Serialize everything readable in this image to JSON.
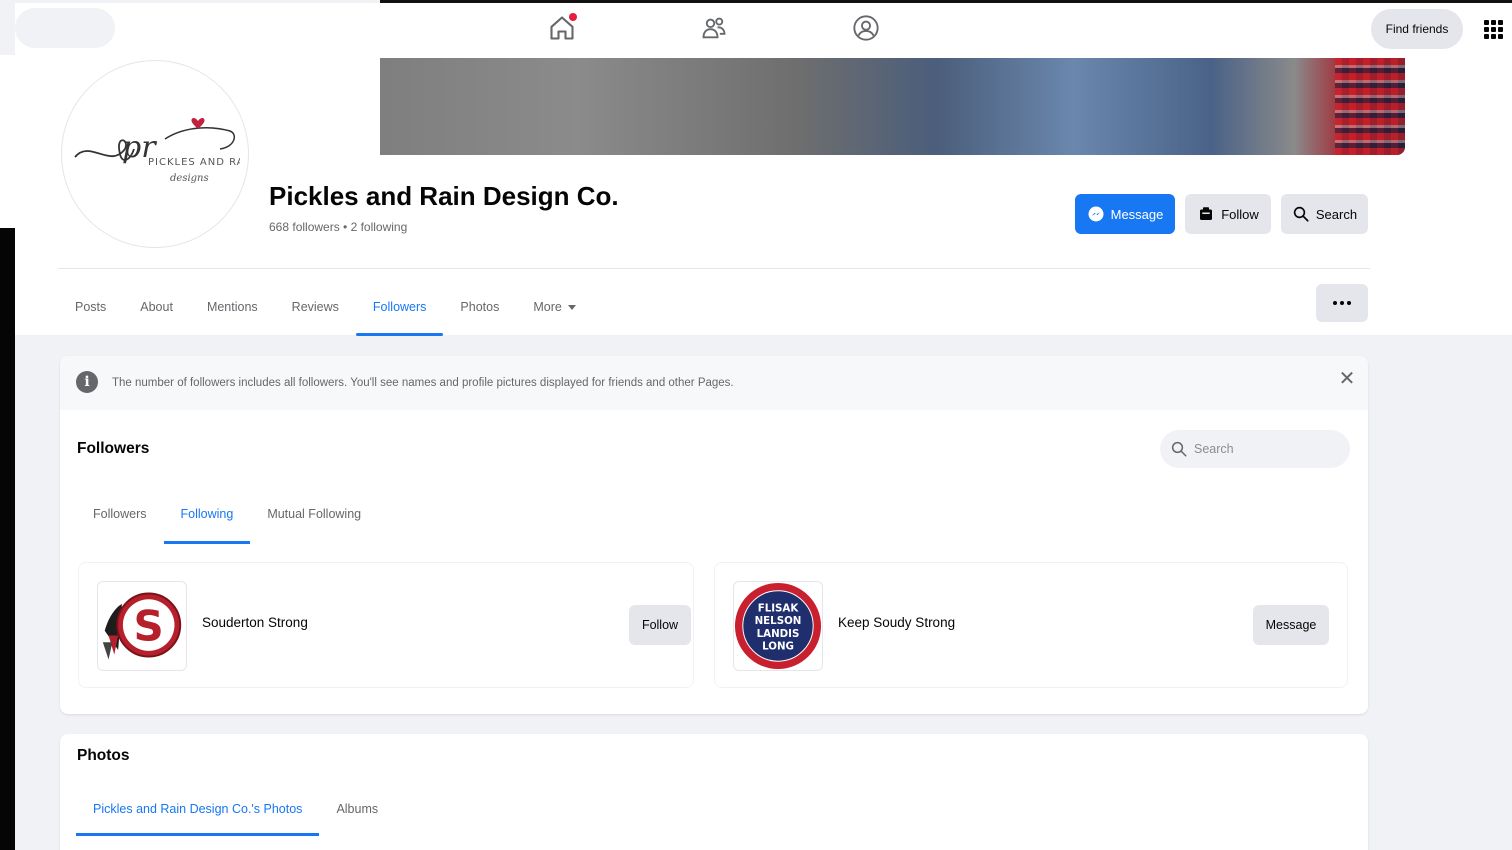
{
  "nav": {
    "home_icon": "home-icon",
    "friends_icon": "friends-icon",
    "profile_icon": "profile-icon",
    "find_friends_label": "Find friends",
    "menu_icon": "grid-menu-icon"
  },
  "page": {
    "title": "Pickles and Rain Design Co.",
    "stats": "668 followers • 2 following",
    "avatar_logo_text": "PICKLES AND RAIN designs",
    "actions": {
      "message": "Message",
      "follow": "Follow",
      "search": "Search"
    },
    "tabs": [
      "Posts",
      "About",
      "Mentions",
      "Reviews",
      "Followers",
      "Photos",
      "More"
    ],
    "active_tab": "Followers"
  },
  "followers": {
    "info_text": "The number of followers includes all followers. You'll see names and profile pictures displayed for friends and other Pages.",
    "title": "Followers",
    "search_placeholder": "Search",
    "subtabs": [
      "Followers",
      "Following",
      "Mutual Following"
    ],
    "active_subtab": "Following",
    "items": [
      {
        "name": "Souderton Strong",
        "button": "Follow",
        "logo_letter": "S"
      },
      {
        "name": "Keep Soudy Strong",
        "button": "Message",
        "logo_lines": [
          "FLISAK",
          "NELSON",
          "LANDIS",
          "LONG"
        ]
      }
    ]
  },
  "photos": {
    "title": "Photos",
    "tabs": [
      "Pickles and Rain Design Co.'s Photos",
      "Albums"
    ],
    "active_tab": "Pickles and Rain Design Co.'s Photos"
  },
  "colors": {
    "accent": "#1877f2",
    "background": "#f0f2f5",
    "secondary_button": "#e4e6eb",
    "notification": "#e41e3f"
  }
}
